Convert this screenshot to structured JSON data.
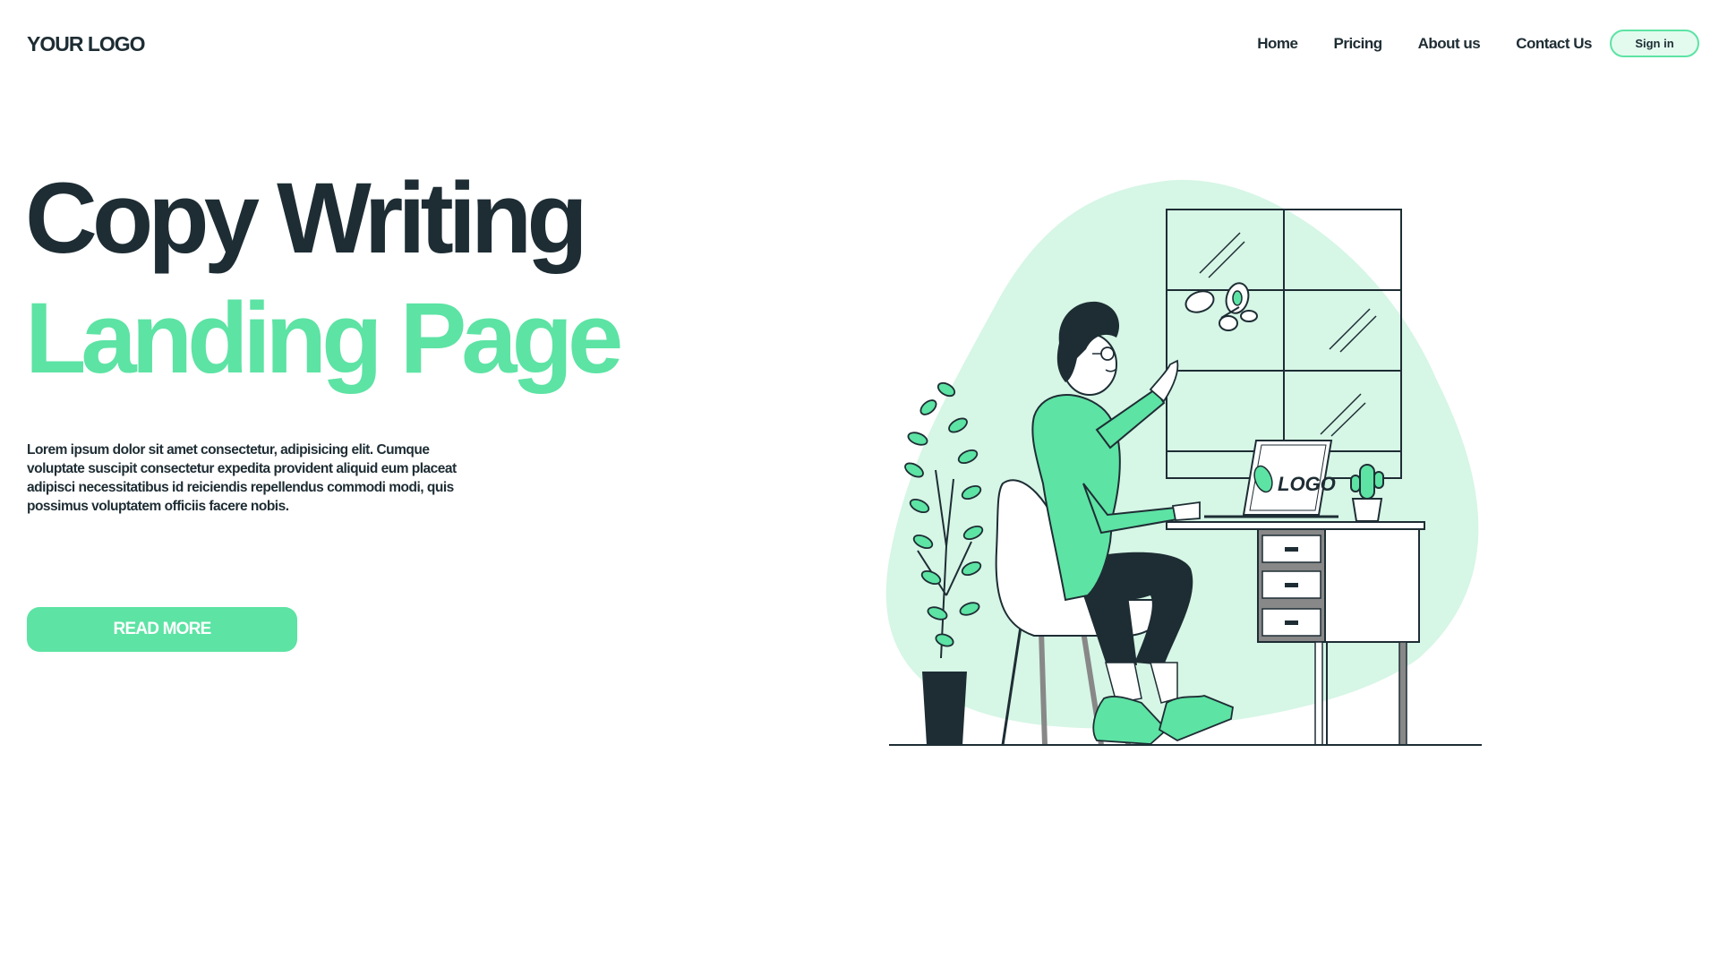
{
  "header": {
    "logo": "YOUR LOGO",
    "nav": [
      "Home",
      "Pricing",
      "About us",
      "Contact Us"
    ],
    "signin_label": "Sign in"
  },
  "hero": {
    "title_line1": "Copy Writing",
    "title_line2": "Landing Page",
    "description": "Lorem ipsum dolor sit amet consectetur, adipisicing elit. Cumque voluptate suscipit consectetur expedita provident aliquid eum placeat adipisci necessitatibus id reiciendis repellendus commodi modi, quis possimus voluptatem officiis facere nobis.",
    "cta_label": "READ MORE"
  },
  "illustration": {
    "laptop_logo_text": "LOGO",
    "icons": [
      "butterfly-icon",
      "plant-icon",
      "cactus-icon",
      "chair-icon",
      "desk-icon",
      "laptop-icon"
    ]
  },
  "colors": {
    "accent": "#5de3a4",
    "accent_light": "#d6f6e6",
    "dark": "#1e2d34",
    "background": "#ffffff"
  }
}
